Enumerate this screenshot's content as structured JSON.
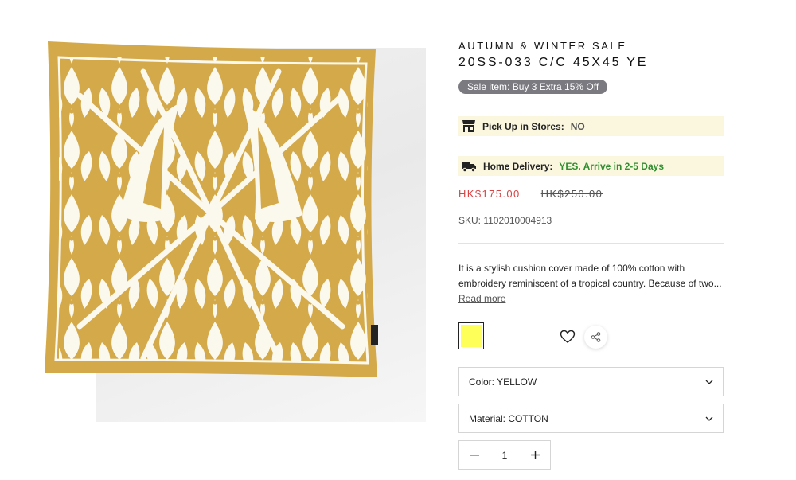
{
  "product": {
    "collection": "AUTUMN & WINTER SALE",
    "title": "20SS-033 C/C 45X45 YE",
    "sale_badge": "Sale item: Buy 3 Extra 15% Off",
    "image_alt_icon": "cushion-image"
  },
  "availability": {
    "pickup": {
      "icon": "store-icon",
      "label": "Pick Up in Stores:",
      "value": "NO"
    },
    "delivery": {
      "icon": "truck-icon",
      "label": "Home Delivery:",
      "value": "YES. Arrive in 2-5 Days"
    }
  },
  "price": {
    "sale": "HK$175.00",
    "original": "HK$250.00"
  },
  "sku": "SKU: 1102010004913",
  "description": {
    "text": "It is a stylish cushion cover made of 100% cotton with embroidery reminiscent of a tropical country. Because of two...",
    "read_more": "Read more"
  },
  "swatch": {
    "color_name": "yellow",
    "color": "#ffff5a"
  },
  "actions": {
    "wishlist_icon": "heart-icon",
    "share_icon": "share-icon"
  },
  "options": {
    "color_select": "Color: YELLOW",
    "material_select": "Material: COTTON"
  },
  "quantity": {
    "value": "1",
    "decrement": "minus-icon",
    "increment": "plus-icon"
  },
  "colors": {
    "sale_price": "#d64545",
    "badge_bg": "#7a7a80",
    "availability_bg": "#fbf7df",
    "delivery_yes": "#2f8f2f",
    "cushion_mustard": "#d3a94a",
    "cushion_cream": "#fbf8ee"
  }
}
